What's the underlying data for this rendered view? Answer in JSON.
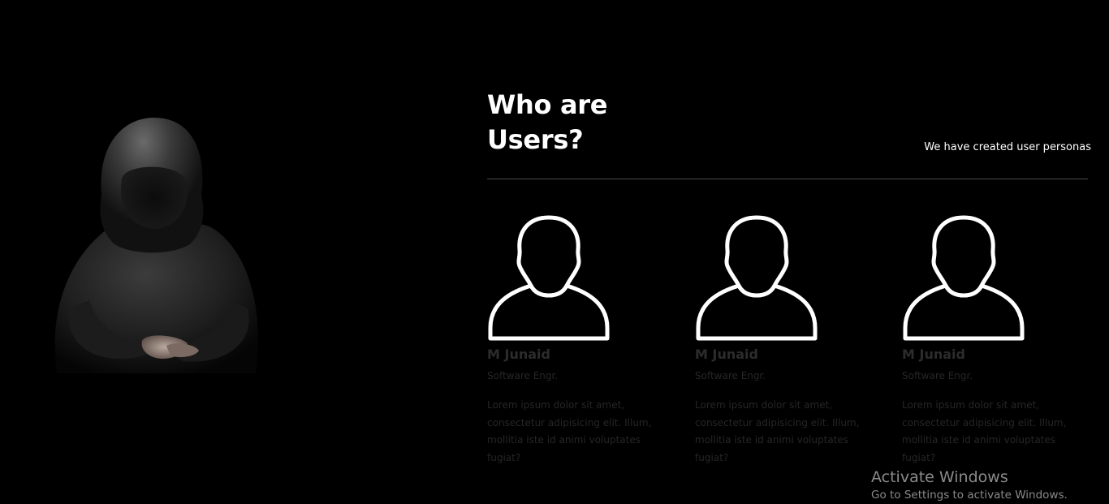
{
  "section": {
    "title": "Who are Users?",
    "subtitle": "We have created user personas"
  },
  "personas": [
    {
      "icon": "user-icon",
      "name": "M Junaid",
      "role": "Software Engr.",
      "description": "Lorem ipsum dolor sit amet, consectetur adipisicing elit. Illum, mollitia iste id animi voluptates fugiat?"
    },
    {
      "icon": "user-icon",
      "name": "M Junaid",
      "role": "Software Engr.",
      "description": "Lorem ipsum dolor sit amet, consectetur adipisicing elit. Illum, mollitia iste id animi voluptates fugiat?"
    },
    {
      "icon": "user-icon",
      "name": "M Junaid",
      "role": "Software Engr.",
      "description": "Lorem ipsum dolor sit amet, consectetur adipisicing elit. Illum, mollitia iste id animi voluptates fugiat?"
    }
  ],
  "watermark": {
    "title": "Activate Windows",
    "subtitle": "Go to Settings to activate Windows."
  },
  "colors": {
    "background": "#000000",
    "heading": "#ffffff",
    "muted_text": "#262626",
    "divider": "#4a4a4a"
  }
}
